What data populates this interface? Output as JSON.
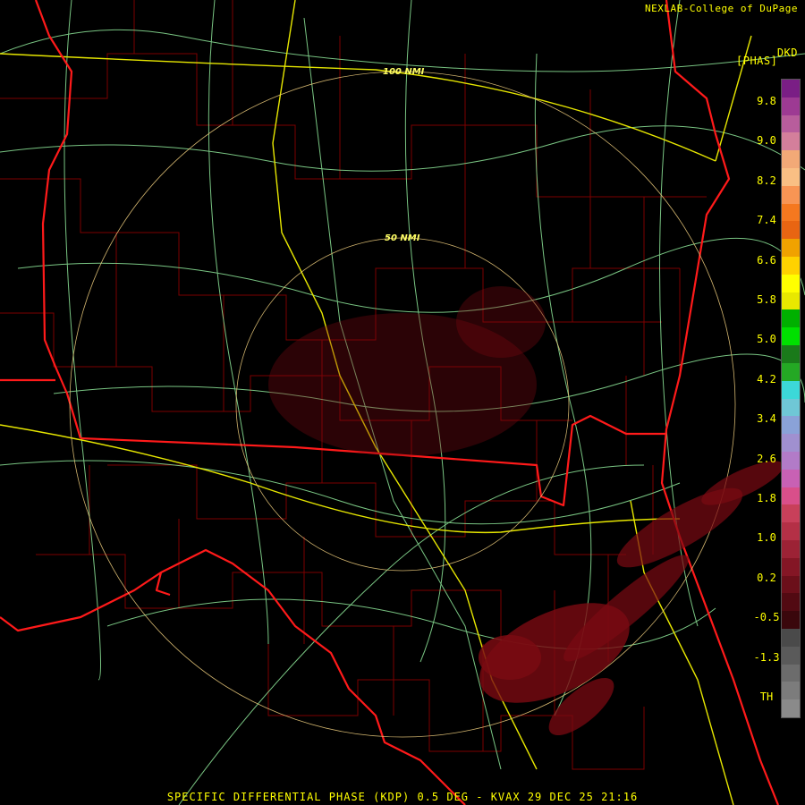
{
  "header": {
    "credit": "NEXLAB-College of DuPage",
    "product_code": "DKD",
    "unit": "[PHAS]"
  },
  "footer": {
    "caption": "SPECIFIC DIFFERENTIAL PHASE (KDP) 0.5 DEG - KVAX 29 DEC 25 21:16"
  },
  "map": {
    "range_rings": [
      "50 NMI",
      "100 NMI"
    ]
  },
  "legend": {
    "labels": [
      "9.8",
      "9.0",
      "8.2",
      "7.4",
      "6.6",
      "5.8",
      "5.0",
      "4.2",
      "3.4",
      "2.6",
      "1.8",
      "1.0",
      "0.2",
      "-0.5",
      "-1.3",
      "TH"
    ],
    "colors": [
      "#7a1e85",
      "#9d3a93",
      "#b85d9c",
      "#d47f9b",
      "#f2a977",
      "#f9bf84",
      "#f89554",
      "#f5781f",
      "#e86512",
      "#f0a200",
      "#ffd200",
      "#ffff00",
      "#e8e800",
      "#00b000",
      "#00e000",
      "#1a7a1a",
      "#24a824",
      "#3cd8d8",
      "#6fc7d6",
      "#8aa2d8",
      "#a090d0",
      "#b27bc8",
      "#c861b4",
      "#d94f8a",
      "#c8405a",
      "#b43046",
      "#9c2235",
      "#841625",
      "#6b0f1a",
      "#520a12",
      "#3a070c",
      "#4a4a4a",
      "#5a5a5a",
      "#6c6c6c",
      "#7c7c7c",
      "#8a8a8a"
    ]
  }
}
